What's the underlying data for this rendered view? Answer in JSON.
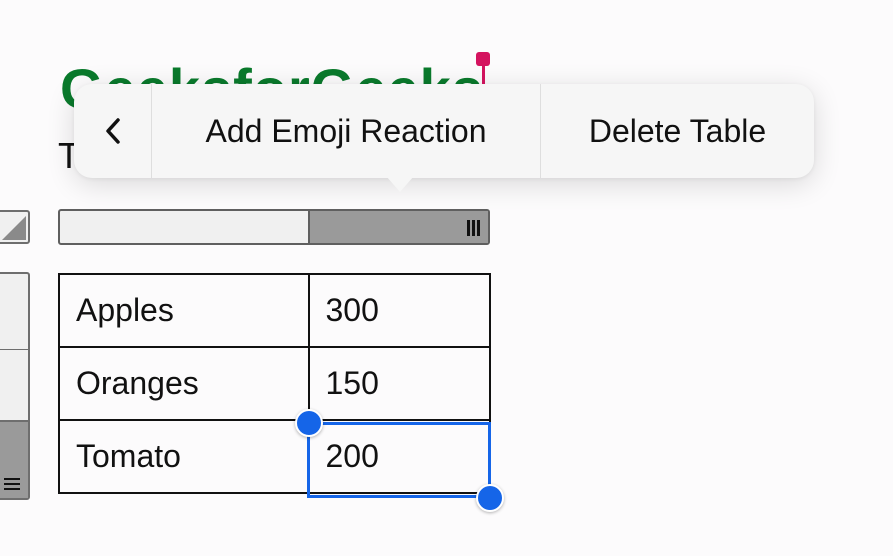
{
  "document": {
    "title": "GeeksforGeeks",
    "partial_text": "T"
  },
  "context_menu": {
    "back_label": "back",
    "items": [
      {
        "label": "Add Emoji Reaction"
      },
      {
        "label": "Delete Table"
      }
    ]
  },
  "table": {
    "rows": [
      [
        "Apples",
        "300"
      ],
      [
        "Oranges",
        "150"
      ],
      [
        "Tomato",
        "200"
      ]
    ],
    "selected_cell": {
      "row": 2,
      "col": 1
    }
  },
  "colors": {
    "title": "#0a7a2c",
    "cursor": "#d4135f",
    "selection": "#1565e8"
  }
}
